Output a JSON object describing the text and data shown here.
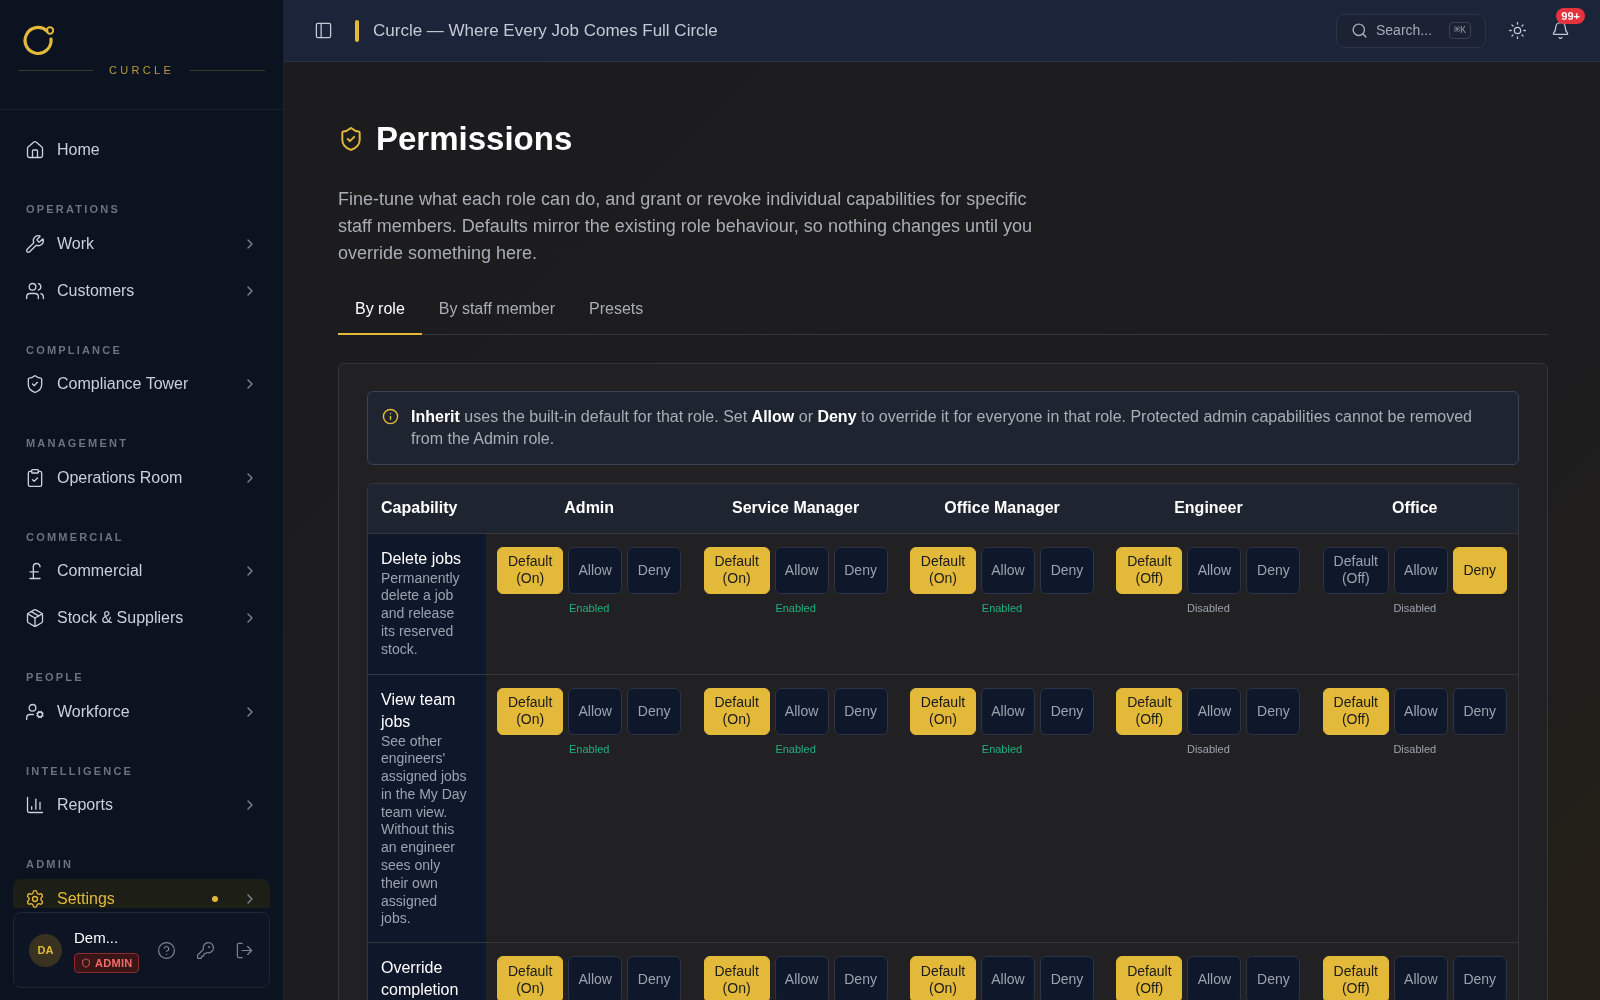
{
  "sidebar": {
    "brand": "CURCLE",
    "items": [
      {
        "kind": "nav",
        "label": "Home",
        "selected": false,
        "chevron": false,
        "dot": false
      },
      {
        "kind": "section",
        "label": "OPERATIONS"
      },
      {
        "kind": "nav",
        "label": "Work",
        "selected": false,
        "chevron": true,
        "dot": false
      },
      {
        "kind": "nav",
        "label": "Customers",
        "selected": false,
        "chevron": true,
        "dot": false
      },
      {
        "kind": "section",
        "label": "COMPLIANCE"
      },
      {
        "kind": "nav",
        "label": "Compliance Tower",
        "selected": false,
        "chevron": true,
        "dot": false
      },
      {
        "kind": "section",
        "label": "MANAGEMENT"
      },
      {
        "kind": "nav",
        "label": "Operations Room",
        "selected": false,
        "chevron": true,
        "dot": false
      },
      {
        "kind": "section",
        "label": "COMMERCIAL"
      },
      {
        "kind": "nav",
        "label": "Commercial",
        "selected": false,
        "chevron": true,
        "dot": false
      },
      {
        "kind": "nav",
        "label": "Stock & Suppliers",
        "selected": false,
        "chevron": true,
        "dot": false
      },
      {
        "kind": "section",
        "label": "PEOPLE"
      },
      {
        "kind": "nav",
        "label": "Workforce",
        "selected": false,
        "chevron": true,
        "dot": false
      },
      {
        "kind": "section",
        "label": "INTELLIGENCE"
      },
      {
        "kind": "nav",
        "label": "Reports",
        "selected": false,
        "chevron": true,
        "dot": false
      },
      {
        "kind": "section",
        "label": "ADMIN"
      },
      {
        "kind": "nav",
        "label": "Settings",
        "selected": true,
        "chevron": true,
        "dot": true
      }
    ],
    "user": {
      "initials": "DA",
      "name": "Dem...",
      "role": "ADMIN"
    }
  },
  "header": {
    "title": "Curcle — Where Every Job Comes Full Circle",
    "search": {
      "placeholder": "Search...",
      "shortcut": "⌘K"
    },
    "notifications": "99+"
  },
  "page": {
    "title": "Permissions",
    "description": "Fine-tune what each role can do, and grant or revoke individual capabilities for specific staff members. Defaults mirror the existing role behaviour, so nothing changes until you override something here.",
    "tabs": [
      {
        "label": "By role",
        "selected": true
      },
      {
        "label": "By staff member",
        "selected": false
      },
      {
        "label": "Presets",
        "selected": false
      }
    ],
    "notice": "**Inherit** uses the built-in default for that role. Set **Allow** or **Deny** to override it for everyone in that role. Protected admin capabilities cannot be removed from the Admin role.",
    "table": {
      "capability_header": "Capability",
      "roles": [
        "Admin",
        "Service Manager",
        "Office Manager",
        "Engineer",
        "Office"
      ],
      "rows": [
        {
          "name": "Delete jobs",
          "description": "Permanently delete a job and release its reserved stock.",
          "cells": [
            {
              "options": [
                {
                  "label": "Default (On)",
                  "selected": true
                },
                {
                  "label": "Allow",
                  "selected": false
                },
                {
                  "label": "Deny",
                  "selected": false
                }
              ],
              "status": {
                "text": "Enabled",
                "kind": "enabled"
              }
            },
            {
              "options": [
                {
                  "label": "Default (On)",
                  "selected": true
                },
                {
                  "label": "Allow",
                  "selected": false
                },
                {
                  "label": "Deny",
                  "selected": false
                }
              ],
              "status": {
                "text": "Enabled",
                "kind": "enabled"
              }
            },
            {
              "options": [
                {
                  "label": "Default (On)",
                  "selected": true
                },
                {
                  "label": "Allow",
                  "selected": false
                },
                {
                  "label": "Deny",
                  "selected": false
                }
              ],
              "status": {
                "text": "Enabled",
                "kind": "enabled"
              }
            },
            {
              "options": [
                {
                  "label": "Default (Off)",
                  "selected": true
                },
                {
                  "label": "Allow",
                  "selected": false
                },
                {
                  "label": "Deny",
                  "selected": false
                }
              ],
              "status": {
                "text": "Disabled",
                "kind": "disabled"
              }
            },
            {
              "options": [
                {
                  "label": "Default (Off)",
                  "selected": false
                },
                {
                  "label": "Allow",
                  "selected": false
                },
                {
                  "label": "Deny",
                  "selected": true
                }
              ],
              "status": {
                "text": "Disabled",
                "kind": "disabled"
              }
            }
          ]
        },
        {
          "name": "View team jobs",
          "description": "See other engineers' assigned jobs in the My Day team view. Without this an engineer sees only their own assigned jobs.",
          "cells": [
            {
              "options": [
                {
                  "label": "Default (On)",
                  "selected": true
                },
                {
                  "label": "Allow",
                  "selected": false
                },
                {
                  "label": "Deny",
                  "selected": false
                }
              ],
              "status": {
                "text": "Enabled",
                "kind": "enabled"
              }
            },
            {
              "options": [
                {
                  "label": "Default (On)",
                  "selected": true
                },
                {
                  "label": "Allow",
                  "selected": false
                },
                {
                  "label": "Deny",
                  "selected": false
                }
              ],
              "status": {
                "text": "Enabled",
                "kind": "enabled"
              }
            },
            {
              "options": [
                {
                  "label": "Default (On)",
                  "selected": true
                },
                {
                  "label": "Allow",
                  "selected": false
                },
                {
                  "label": "Deny",
                  "selected": false
                }
              ],
              "status": {
                "text": "Enabled",
                "kind": "enabled"
              }
            },
            {
              "options": [
                {
                  "label": "Default (Off)",
                  "selected": true
                },
                {
                  "label": "Allow",
                  "selected": false
                },
                {
                  "label": "Deny",
                  "selected": false
                }
              ],
              "status": {
                "text": "Disabled",
                "kind": "disabled"
              }
            },
            {
              "options": [
                {
                  "label": "Default (Off)",
                  "selected": true
                },
                {
                  "label": "Allow",
                  "selected": false
                },
                {
                  "label": "Deny",
                  "selected": false
                }
              ],
              "status": {
                "text": "Disabled",
                "kind": "disabled"
              }
            }
          ]
        },
        {
          "name": "Override completion",
          "cells": [
            {
              "options": [
                {
                  "label": "Default (On)",
                  "selected": true
                },
                {
                  "label": "Allow",
                  "selected": false
                },
                {
                  "label": "Deny",
                  "selected": false
                }
              ]
            },
            {
              "options": [
                {
                  "label": "Default (On)",
                  "selected": true
                },
                {
                  "label": "Allow",
                  "selected": false
                },
                {
                  "label": "Deny",
                  "selected": false
                }
              ]
            },
            {
              "options": [
                {
                  "label": "Default (On)",
                  "selected": true
                },
                {
                  "label": "Allow",
                  "selected": false
                },
                {
                  "label": "Deny",
                  "selected": false
                }
              ]
            },
            {
              "options": [
                {
                  "label": "Default (Off)",
                  "selected": true
                },
                {
                  "label": "Allow",
                  "selected": false
                },
                {
                  "label": "Deny",
                  "selected": false
                }
              ]
            },
            {
              "options": [
                {
                  "label": "Default (Off)",
                  "selected": true
                },
                {
                  "label": "Allow",
                  "selected": false
                },
                {
                  "label": "Deny",
                  "selected": false
                }
              ]
            }
          ]
        }
      ]
    }
  }
}
